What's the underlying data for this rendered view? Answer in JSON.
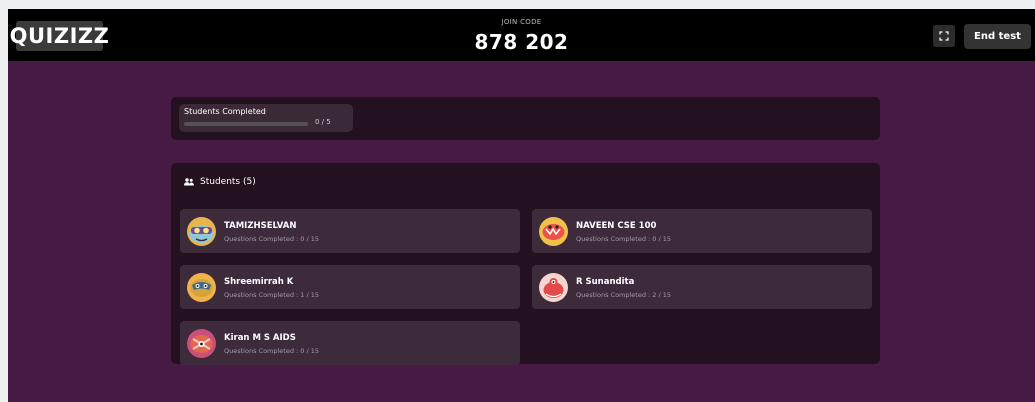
{
  "app": {
    "logo_text": "QUIZIZZ"
  },
  "header": {
    "join_label": "JOIN CODE",
    "join_code": "878 202",
    "end_button": "End test"
  },
  "completed": {
    "title": "Students Completed",
    "count_text": "0 / 5",
    "progress_fraction": 0
  },
  "students": {
    "title": "Students (5)",
    "items": [
      {
        "name": "TAMIZHSELVAN",
        "progress": "Questions Completed : 0 / 15",
        "avatar": "monster-yellow-goggles-icon"
      },
      {
        "name": "NAVEEN CSE 100",
        "progress": "Questions Completed : 0 / 15",
        "avatar": "monster-orange-icon"
      },
      {
        "name": "Shreemirrah K",
        "progress": "Questions Completed : 1 / 15",
        "avatar": "monster-yellow-mask-icon"
      },
      {
        "name": "R Sunandita",
        "progress": "Questions Completed : 2 / 15",
        "avatar": "monster-red-icon"
      },
      {
        "name": "Kiran M S AIDS",
        "progress": "Questions Completed : 0 / 15",
        "avatar": "monster-pink-icon"
      }
    ]
  },
  "colors": {
    "background": "#461a42",
    "topbar": "#000000",
    "panel": "#231120",
    "card": "#3d2a3b"
  }
}
